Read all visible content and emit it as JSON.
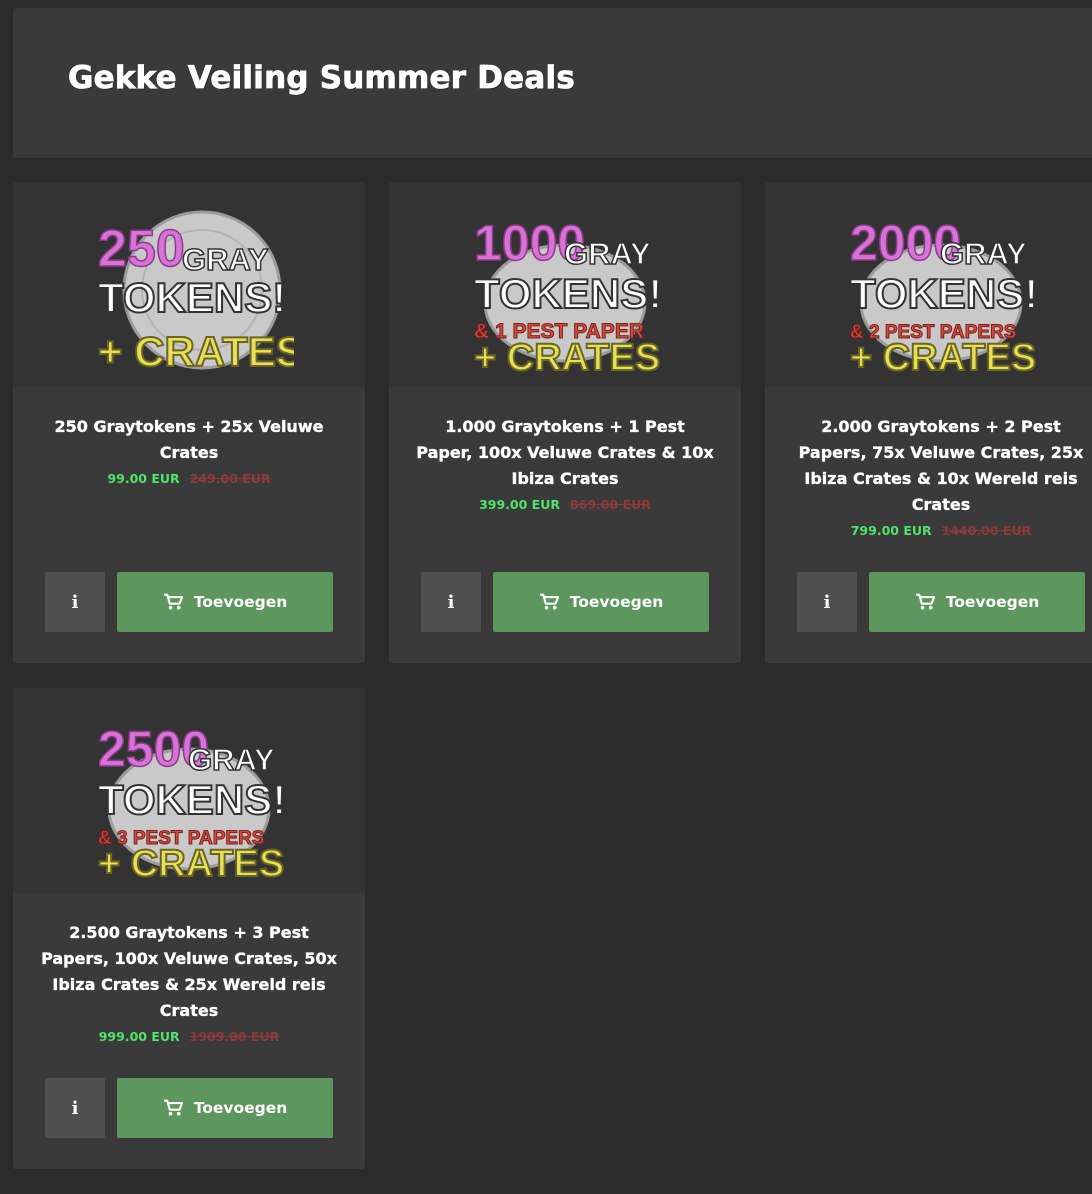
{
  "page": {
    "title": "Gekke Veiling Summer Deals"
  },
  "products": [
    {
      "image": {
        "number": "250",
        "gray": "GRAY",
        "tokens": "TOKENS!",
        "extra": "",
        "crates": "+ CRATES"
      },
      "title": "250 Graytokens + 25x Veluwe Crates",
      "price": "99.00 EUR",
      "old_price": "249.00 EUR",
      "info_label": "i",
      "add_label": "Toevoegen"
    },
    {
      "image": {
        "number": "1000",
        "gray": "GRAY",
        "tokens": "TOKENS!",
        "extra": "& 1 PEST PAPER",
        "crates": "+ CRATES"
      },
      "title": "1.000 Graytokens + 1 Pest Paper, 100x Veluwe Crates & 10x Ibiza Crates",
      "price": "399.00 EUR",
      "old_price": "869.00 EUR",
      "info_label": "i",
      "add_label": "Toevoegen"
    },
    {
      "image": {
        "number": "2000",
        "gray": "GRAY",
        "tokens": "TOKENS!",
        "extra": "& 2 PEST PAPERS",
        "crates": "+ CRATES"
      },
      "title": "2.000 Graytokens + 2 Pest Papers, 75x Veluwe Crates, 25x Ibiza Crates & 10x Wereld reis Crates",
      "price": "799.00 EUR",
      "old_price": "1440.00 EUR",
      "info_label": "i",
      "add_label": "Toevoegen"
    },
    {
      "image": {
        "number": "2500",
        "gray": "GRAY",
        "tokens": "TOKENS!",
        "extra": "& 3 PEST PAPERS",
        "crates": "+ CRATES"
      },
      "title": "2.500 Graytokens + 3 Pest Papers, 100x Veluwe Crates, 50x Ibiza Crates & 25x Wereld reis Crates",
      "price": "999.00 EUR",
      "old_price": "1909.00 EUR",
      "info_label": "i",
      "add_label": "Toevoegen"
    }
  ],
  "colors": {
    "background": "#2b2b2b",
    "card": "#3a3a3a",
    "price_new": "#4ee56a",
    "price_old": "#8f3a3a",
    "add_button": "#5e975e",
    "info_button": "#505050",
    "number_pink": "#d873d6",
    "crates_yellow": "#e6df5a",
    "pest_red": "#d94a3e"
  },
  "icons": {
    "cart": "cart-icon"
  }
}
